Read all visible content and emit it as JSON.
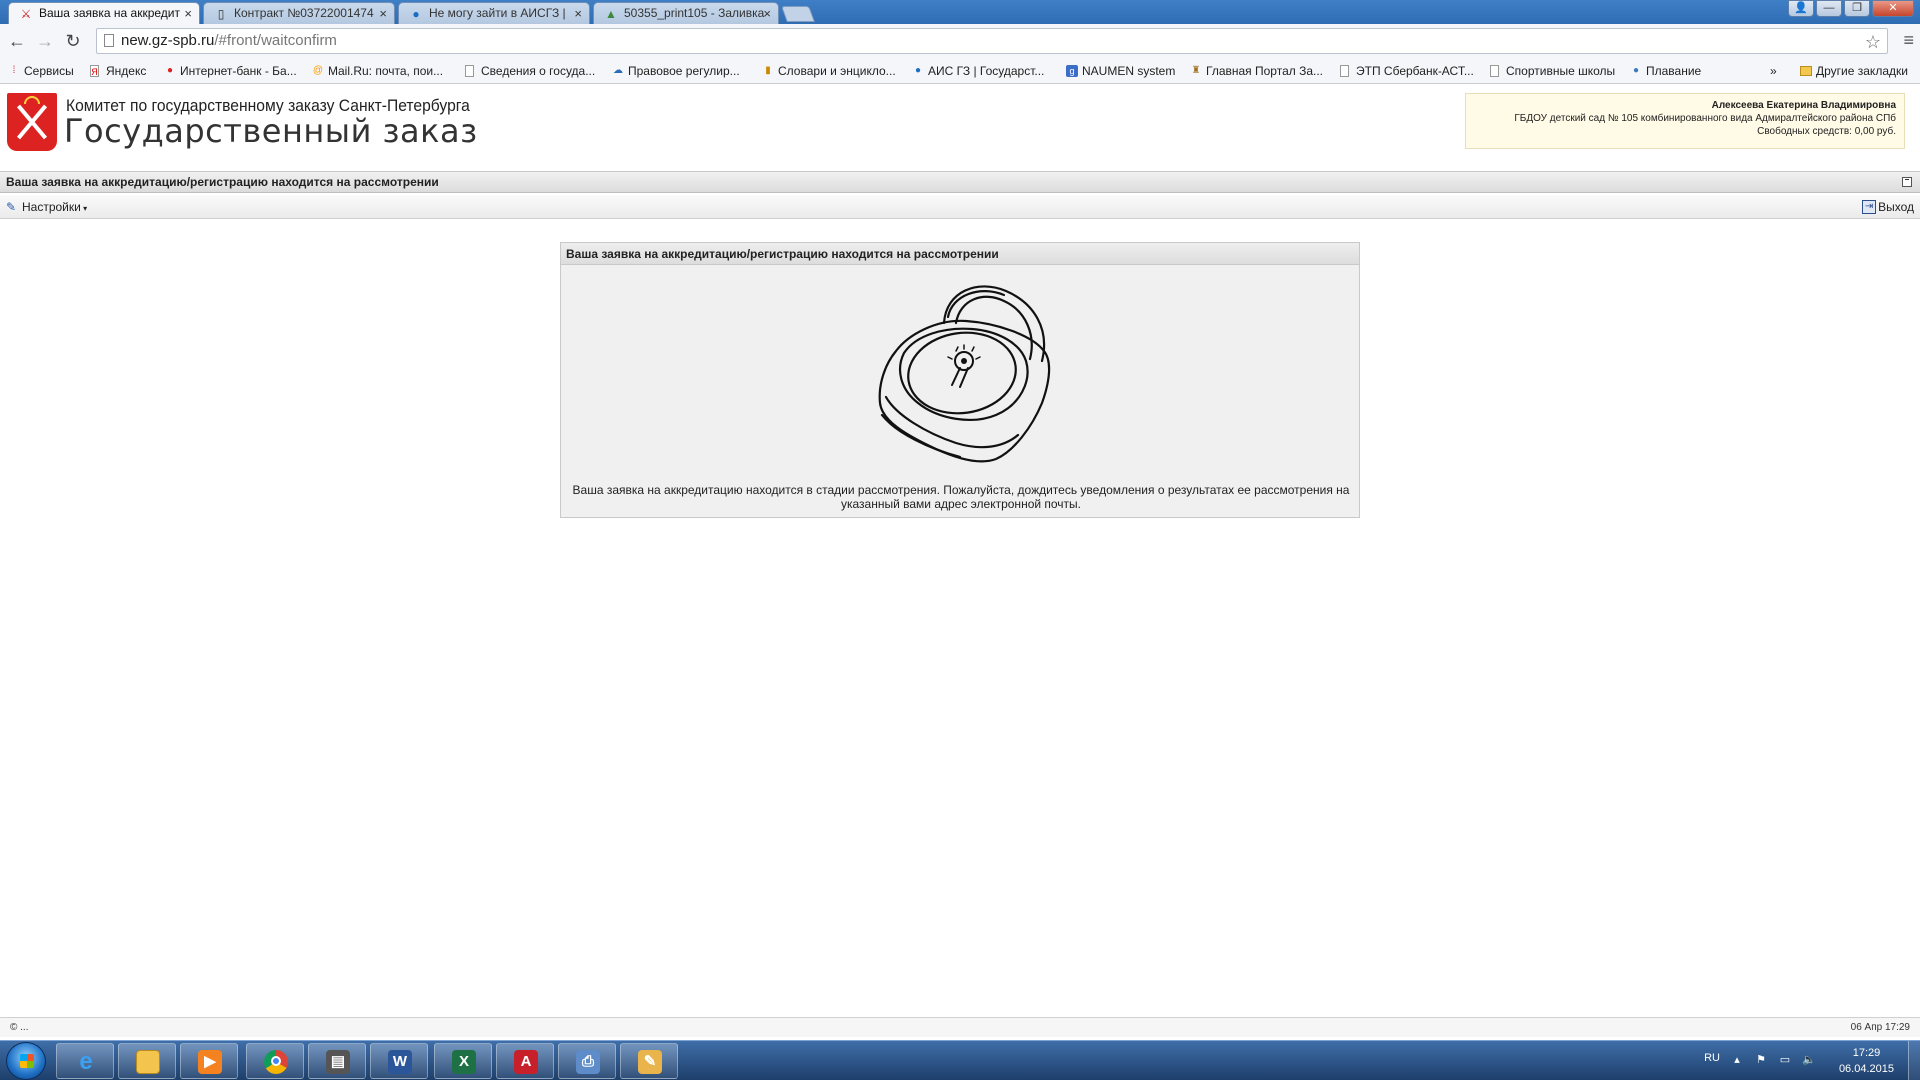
{
  "browser": {
    "tabs": [
      {
        "title": "Ваша заявка на аккредит",
        "icon": "spb-emblem-icon",
        "active": true
      },
      {
        "title": "Контракт №03722001474",
        "icon": "page-icon",
        "active": false
      },
      {
        "title": "Не могу зайти в АИСГЗ |",
        "icon": "globe-icon",
        "active": false
      },
      {
        "title": "50355_print105 - Заливка",
        "icon": "drive-icon",
        "active": false
      }
    ],
    "url_host": "new.gz-spb.ru",
    "url_path": "/#front/waitconfirm",
    "bookmarks": [
      {
        "label": "Сервисы",
        "icon": "apps-grid-icon"
      },
      {
        "label": "Яндекс",
        "icon": "yandex-icon"
      },
      {
        "label": "Интернет-банк - Ба...",
        "icon": "bank-icon"
      },
      {
        "label": "Mail.Ru: почта, пои...",
        "icon": "mailru-icon"
      },
      {
        "label": "Сведения о госуда...",
        "icon": "page-icon"
      },
      {
        "label": "Правовое регулир...",
        "icon": "cloud-icon"
      },
      {
        "label": "Словари и энцикло...",
        "icon": "chart-icon"
      },
      {
        "label": "АИС ГЗ | Государст...",
        "icon": "globe-icon"
      },
      {
        "label": "NAUMEN system",
        "icon": "naumen-icon"
      },
      {
        "label": "Главная Портал За...",
        "icon": "eagle-icon"
      },
      {
        "label": "ЭТП Сбербанк-АСТ...",
        "icon": "page-icon"
      },
      {
        "label": "Спортивные школы",
        "icon": "page-icon"
      },
      {
        "label": "Плавание",
        "icon": "globe-icon"
      }
    ],
    "overflow_label": "»",
    "other_bookmarks": "Другие закладки"
  },
  "header": {
    "org_name": "Комитет по государственному заказу Санкт-Петербурга",
    "site_name": "Государственный заказ",
    "user": {
      "name": "Алексеева Екатерина Владимировна",
      "org": "ГБДОУ детский сад № 105 комбинированного вида Адмиралтейского района СПб",
      "funds": "Свободных средств: 0,00 руб."
    }
  },
  "window": {
    "title": "Ваша заявка на аккредитацию/регистрацию находится на рассмотрении"
  },
  "app_toolbar": {
    "settings_label": "Настройки",
    "logout_label": "Выход"
  },
  "panel": {
    "title": "Ваша заявка на аккредитацию/регистрацию находится на рассмотрении",
    "message": "Ваша заявка на аккредитацию находится в стадии рассмотрения. Пожалуйста, дождитесь уведомления о результатах ее рассмотрения на указанный вами адрес электронной почты."
  },
  "statusbar": {
    "left": "© ...",
    "right": "06 Апр 17:29"
  },
  "taskbar": {
    "apps": [
      "ie-icon",
      "explorer-icon",
      "media-player-icon",
      "chrome-icon",
      "printer-icon",
      "word-icon",
      "excel-icon",
      "acrobat-icon",
      "scanner-icon",
      "paint-icon"
    ],
    "lang": "RU",
    "time": "17:29",
    "date": "06.04.2015"
  }
}
